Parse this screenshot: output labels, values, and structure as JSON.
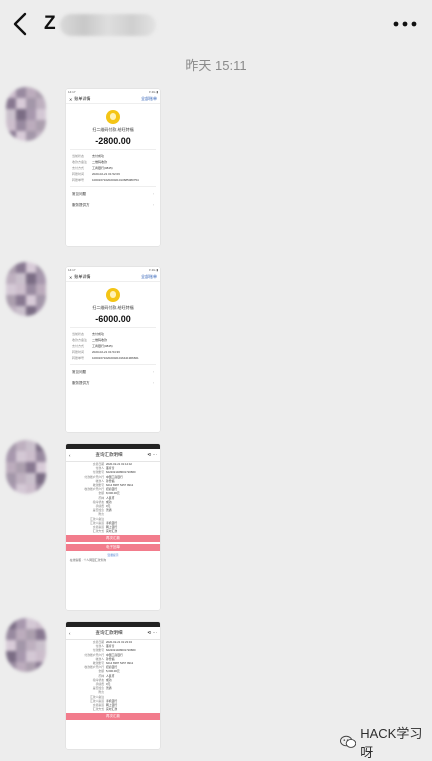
{
  "header": {
    "title": "Z",
    "timestamp": "昨天 15:11"
  },
  "watermark": "HACK学习呀",
  "avatar_colors": [
    "#c9b9c9",
    "#8f7f97",
    "#b7a6b8",
    "#a597a8",
    "#7d6c87",
    "#d6c8d6",
    "#9c8ea2",
    "#b9aabb",
    "#c7bcc9",
    "#6e5f79",
    "#a08fa7",
    "#d2c5d3"
  ],
  "receipt1": {
    "status_bar": {
      "time": "14:17",
      "right": "▾ 4G ▮"
    },
    "back": "✕",
    "header_title": "账单详情",
    "header_action": "全部账单",
    "merchant": "扫二维码付款-给旺特福",
    "amount": "-2800.00",
    "rows": [
      {
        "k": "当前状态",
        "v": "支付成功"
      },
      {
        "k": "收款方备注",
        "v": "二维码收款"
      },
      {
        "k": "支付方式",
        "v": "工商银行(0845)"
      },
      {
        "k": "转账时间",
        "v": "2020-02-21 01:52:06"
      },
      {
        "k": "转账单号",
        "v": "1000167102020021013685080754"
      }
    ],
    "links": [
      "常见问题",
      "服务提供方"
    ]
  },
  "receipt2": {
    "status_bar": {
      "time": "14:17",
      "right": "▾ 4G ▮"
    },
    "back": "✕",
    "header_title": "账单详情",
    "header_action": "全部账单",
    "merchant": "扫二维码付款-给旺特福",
    "amount": "-6000.00",
    "rows": [
      {
        "k": "当前状态",
        "v": "支付成功"
      },
      {
        "k": "收款方备注",
        "v": "二维码收款"
      },
      {
        "k": "支付方式",
        "v": "工商银行(0845)"
      },
      {
        "k": "转账时间",
        "v": "2020-02-21 01:54:36"
      },
      {
        "k": "转账单号",
        "v": "1000167102020021016441966661"
      }
    ],
    "links": [
      "常见问题",
      "服务提供方"
    ]
  },
  "bank1": {
    "back": "‹",
    "title": "查询汇款明细",
    "right": "⟲ ···",
    "rows": [
      {
        "k": "交易日期",
        "v": "2020-02-21 01:14:42"
      },
      {
        "k": "付款人",
        "v": "董育奇"
      },
      {
        "k": "付款账号",
        "v": "6222021408001720860"
      },
      {
        "k": "付款账户开户行",
        "v": "中国工商银行"
      },
      {
        "k": "收款人",
        "v": "孙登福"
      },
      {
        "k": "收款账号",
        "v": "6214 8387 5457 9912"
      },
      {
        "k": "收款账户开户行",
        "v": "招商银行"
      },
      {
        "k": "金额",
        "v": "8,000.00元"
      },
      {
        "k": "币种",
        "v": "人民币"
      },
      {
        "k": "指令状态",
        "v": "成功"
      },
      {
        "k": "手续费",
        "v": "0元"
      },
      {
        "k": "是否加急",
        "v": "普通"
      },
      {
        "k": "附言",
        "v": ""
      },
      {
        "k": "汇款人备注",
        "v": ""
      },
      {
        "k": "汇款人渠道",
        "v": "手机银行"
      },
      {
        "k": "交易渠道",
        "v": "网上银行"
      },
      {
        "k": "汇款方式",
        "v": "实时汇款"
      }
    ],
    "btn1": "再次汇款",
    "btn2": "电子回单",
    "foot": "温馨提示",
    "foot2": "·在线客服 · 个人网银汇款查询"
  },
  "bank2": {
    "back": "‹",
    "title": "查询汇款明细",
    "right": "⟲ ···",
    "rows": [
      {
        "k": "交易日期",
        "v": "2020-02-21 01:23:43"
      },
      {
        "k": "付款人",
        "v": "董育奇"
      },
      {
        "k": "付款账号",
        "v": "6222021408001720860"
      },
      {
        "k": "付款账户开户行",
        "v": "中国工商银行"
      },
      {
        "k": "收款人",
        "v": "孙登福"
      },
      {
        "k": "收款账号",
        "v": "6214 8387 5457 9912"
      },
      {
        "k": "收款账户开户行",
        "v": "招商银行"
      },
      {
        "k": "金额",
        "v": "5,000.00元"
      },
      {
        "k": "币种",
        "v": "人民币"
      },
      {
        "k": "指令状态",
        "v": "成功"
      },
      {
        "k": "手续费",
        "v": "0元"
      },
      {
        "k": "是否加急",
        "v": "普通"
      },
      {
        "k": "附言",
        "v": ""
      },
      {
        "k": "汇款人备注",
        "v": ""
      },
      {
        "k": "汇款人渠道",
        "v": "手机银行"
      },
      {
        "k": "交易渠道",
        "v": "网上银行"
      },
      {
        "k": "汇款方式",
        "v": "实时汇款"
      }
    ],
    "btn1": "再次汇款"
  }
}
